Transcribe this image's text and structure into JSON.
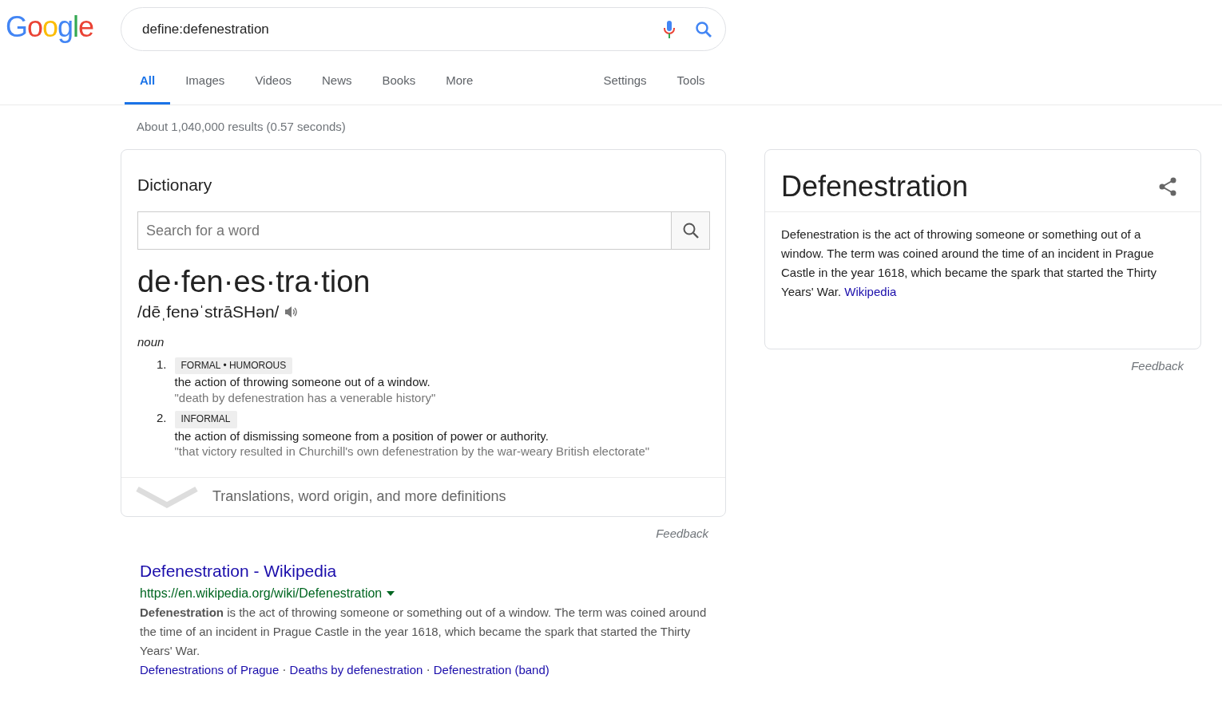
{
  "logo": {
    "text": "Google"
  },
  "search": {
    "value": "define:defenestration"
  },
  "tabs": [
    {
      "label": "All",
      "selected": true
    },
    {
      "label": "Images",
      "selected": false
    },
    {
      "label": "Videos",
      "selected": false
    },
    {
      "label": "News",
      "selected": false
    },
    {
      "label": "Books",
      "selected": false
    },
    {
      "label": "More",
      "selected": false
    }
  ],
  "tools": [
    "Settings",
    "Tools"
  ],
  "result_stats": "About 1,040,000 results (0.57 seconds)",
  "dictionary": {
    "title": "Dictionary",
    "search_placeholder": "Search for a word",
    "headword": "de·fen·es·tra·tion",
    "pronunciation": "/dēˌfenəˈstrāSHən/",
    "part_of_speech": "noun",
    "senses": [
      {
        "number": "1.",
        "label": "FORMAL • HUMOROUS",
        "definition": "the action of throwing someone out of a window.",
        "example": "\"death by defenestration has a venerable history\""
      },
      {
        "number": "2.",
        "label": "INFORMAL",
        "definition": "the action of dismissing someone from a position of power or authority.",
        "example": "\"that victory resulted in Churchill's own defenestration by the war-weary British electorate\""
      }
    ],
    "more": "Translations, word origin, and more definitions",
    "feedback": "Feedback"
  },
  "result": {
    "title": "Defenestration - Wikipedia",
    "url": "https://en.wikipedia.org/wiki/Defenestration",
    "snippet": "**Defenestration** is the act of throwing someone or something out of a window. The term was coined around the time of an incident in Prague Castle in the year 1618, which became the spark that started the Thirty Years' War.",
    "links": [
      {
        "kind": "link",
        "text": "Defenestrations of Prague"
      },
      {
        "kind": "separator",
        "text": "·"
      },
      {
        "kind": "link",
        "text": "Deaths by defenestration"
      },
      {
        "kind": "separator",
        "text": "·"
      },
      {
        "kind": "link",
        "text": "Defenestration (band)"
      }
    ]
  },
  "knowledge_panel": {
    "title": "Defenestration",
    "description": "Defenestration is the act of throwing someone or something out of a window. The term was coined around the time of an incident in Prague Castle in the year 1618, which became the spark that started the Thirty Years' War.",
    "source": "Wikipedia",
    "feedback": "Feedback"
  }
}
